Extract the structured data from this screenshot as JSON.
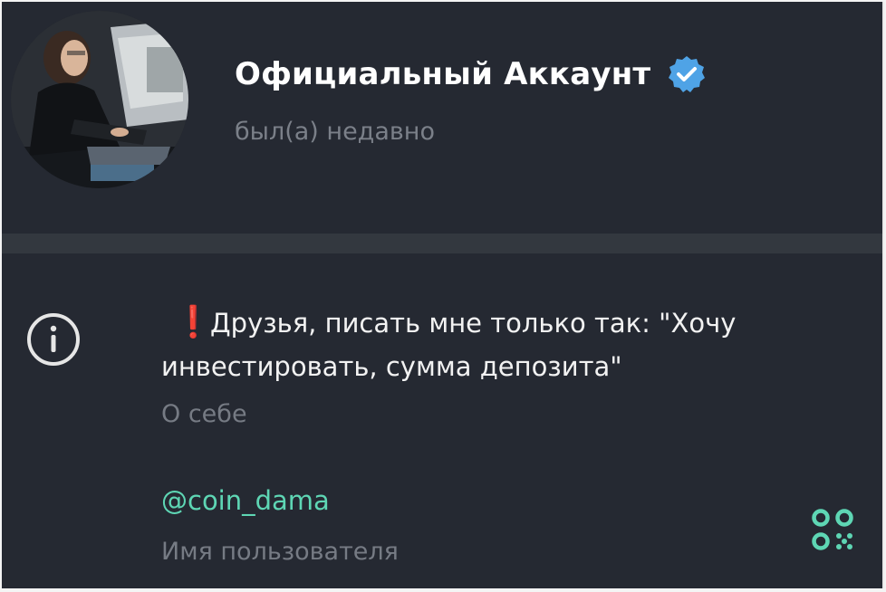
{
  "profile": {
    "name": "Официальный Аккаунт",
    "verified": true,
    "status": "был(а) недавно",
    "avatar_icon": "profile-photo"
  },
  "bio": {
    "icon": "info-icon",
    "emoji": "❗",
    "text": "Друзья, писать мне только так: \"Хочу инвестировать, сумма депозита\"",
    "label": "О себе"
  },
  "username": {
    "value": "@coin_dama",
    "label": "Имя пользователя",
    "qr_icon": "qr-code-icon"
  },
  "colors": {
    "background": "#252932",
    "divider": "#33383f",
    "accent": "#5ed6b4",
    "verified_badge": "#4fa3e6",
    "muted_text": "#767b84"
  }
}
